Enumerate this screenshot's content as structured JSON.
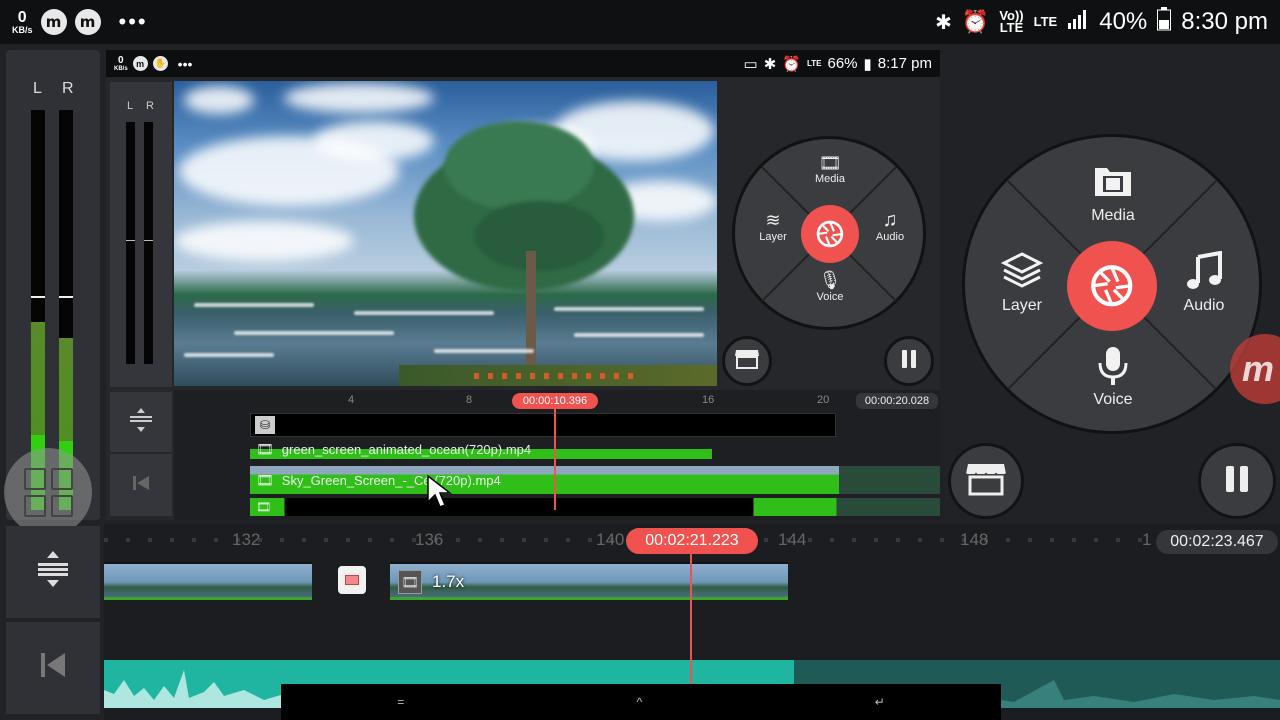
{
  "status_bar": {
    "net_speed_value": "0",
    "net_speed_unit": "KB/s",
    "app_icon_1": "m",
    "app_icon_2": "m",
    "overflow": "•••",
    "volte": "Vo))\nLTE",
    "lte": "LTE",
    "battery": "40%",
    "time": "8:30 pm"
  },
  "outer_meter": {
    "left_label": "L",
    "right_label": "R",
    "left_level": 0.2,
    "right_level": 0.7
  },
  "inner_screen": {
    "status": {
      "net_speed_value": "0",
      "net_speed_unit": "KB/s",
      "overflow": "•••",
      "lte": "LTE",
      "battery": "66%",
      "time": "8:17 pm"
    },
    "meter": {
      "left_label": "L",
      "right_label": "R"
    },
    "circle_menu": {
      "media": "Media",
      "layer": "Layer",
      "audio": "Audio",
      "voice": "Voice"
    },
    "timeline": {
      "ruler": [
        "4",
        "8",
        "12",
        "16",
        "20"
      ],
      "playhead_time": "00:00:10.396",
      "total_time": "00:00:20.028",
      "tracks": [
        {
          "label": "green_screen_animated_ocean(720p).mp4"
        },
        {
          "label": "Sky_Green_Screen_-_Cé (720p).mp4"
        }
      ]
    }
  },
  "circle_menu": {
    "media": "Media",
    "layer": "Layer",
    "audio": "Audio",
    "voice": "Voice"
  },
  "timeline": {
    "ruler": [
      "132",
      "136",
      "140",
      "144",
      "148",
      "1"
    ],
    "playhead_time": "00:02:21.223",
    "total_time": "00:02:23.467",
    "speed_badge": "1.7x"
  },
  "nav_bar": {
    "recents": "=",
    "home": "^",
    "back": "↵"
  },
  "colors": {
    "accent": "#f0524f",
    "track_green": "#2fbf18",
    "audio_teal": "#1fb5a0"
  }
}
